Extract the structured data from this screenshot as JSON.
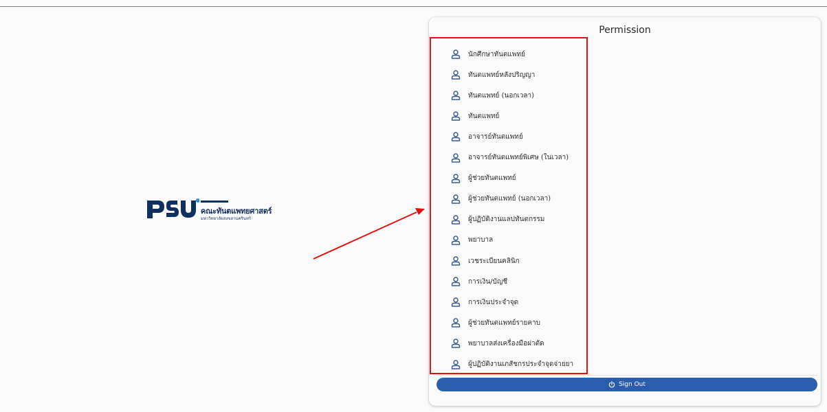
{
  "logo": {
    "mark_text": "PSU",
    "faculty_name": "คณะทันตแพทยศาสตร์",
    "university_name": "มหาวิทยาลัยสงขลานครินทร์"
  },
  "permission_panel": {
    "title": "Permission",
    "items": [
      {
        "label": "นักศึกษาทันตแพทย์",
        "icon": "user-icon"
      },
      {
        "label": "ทันตแพทย์หลังปริญญา",
        "icon": "user-icon"
      },
      {
        "label": "ทันตแพทย์ (นอกเวลา)",
        "icon": "user-icon"
      },
      {
        "label": "ทันตแพทย์",
        "icon": "user-icon"
      },
      {
        "label": "อาจารย์ทันตแพทย์",
        "icon": "user-icon"
      },
      {
        "label": "อาจารย์ทันตแพทย์พิเศษ (ในเวลา)",
        "icon": "user-icon"
      },
      {
        "label": "ผู้ช่วยทันตแพทย์",
        "icon": "user-icon"
      },
      {
        "label": "ผู้ช่วยทันตแพทย์ (นอกเวลา)",
        "icon": "user-icon"
      },
      {
        "label": "ผู้ปฏิบัติงานแลปทันตกรรม",
        "icon": "user-icon"
      },
      {
        "label": "พยาบาล",
        "icon": "user-icon"
      },
      {
        "label": "เวชระเบียนคลินิก",
        "icon": "user-icon"
      },
      {
        "label": "การเงิน/บัญชี",
        "icon": "user-icon"
      },
      {
        "label": "การเงินประจำจุด",
        "icon": "user-icon"
      },
      {
        "label": "ผู้ช่วยทันตแพทย์รายคาบ",
        "icon": "user-icon"
      },
      {
        "label": "พยาบาลส่งเครื่องมือผ่าตัด",
        "icon": "user-icon"
      },
      {
        "label": "ผู้ปฏิบัติงานเภสัชกรประจำจุดจ่ายยา",
        "icon": "user-icon"
      }
    ],
    "sign_out_label": "Sign Out",
    "sign_out_icon": "power-icon"
  },
  "colors": {
    "brand_blue": "#2b5cad",
    "logo_navy": "#0f2f5f",
    "annotation_red": "#e01010",
    "icon_blue": "#3a5a8c"
  }
}
